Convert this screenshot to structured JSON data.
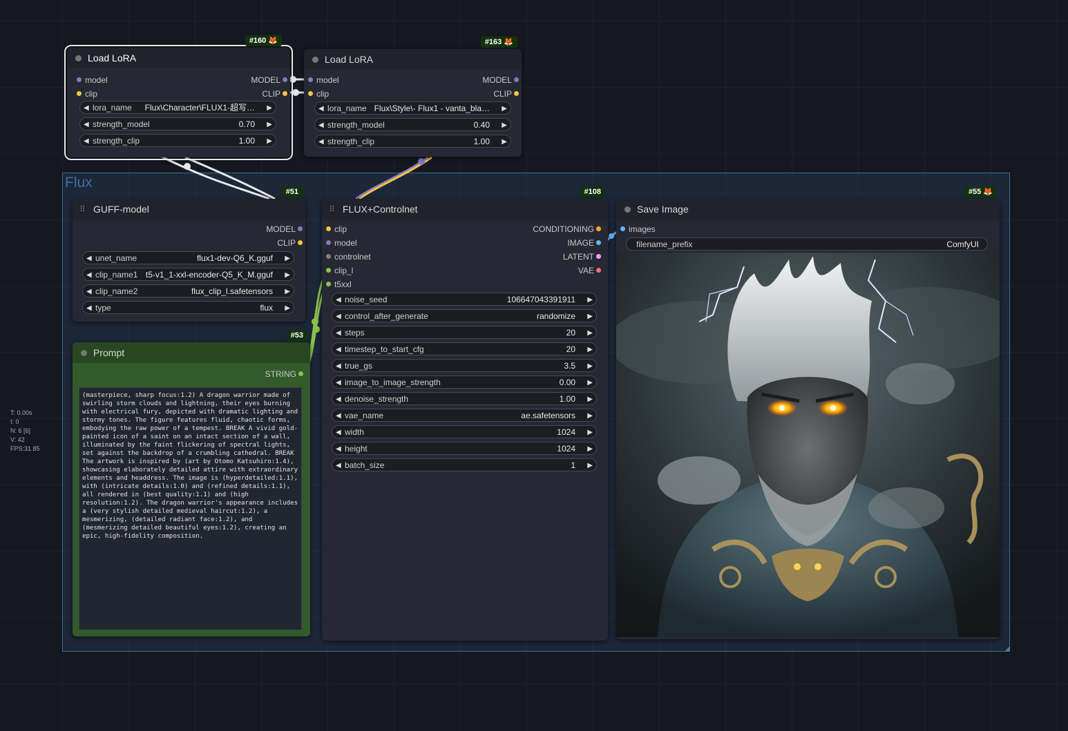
{
  "group": {
    "title": "Flux"
  },
  "stats": [
    "T: 0.00s",
    "I: 0",
    "N: 6 [6]",
    "V: 42",
    "FPS:31.85"
  ],
  "colors": {
    "model_socket": "#8678c4",
    "clip_socket": "#f5c542",
    "image_socket": "#64b5f6",
    "latent_socket": "#ff9cf9",
    "vae_socket": "#ff6e6e",
    "cond_socket": "#ffa931",
    "string_socket": "#8bc34a",
    "controlnet_socket": "#808080"
  },
  "lora1": {
    "badge": "#160",
    "title": "Load LoRA",
    "inputs": [
      "model",
      "clip"
    ],
    "outputs": [
      "MODEL",
      "CLIP"
    ],
    "widgets": [
      {
        "name": "lora_name",
        "value": "Flux\\Character\\FLUX1-超写…"
      },
      {
        "name": "strength_model",
        "value": "0.70"
      },
      {
        "name": "strength_clip",
        "value": "1.00"
      }
    ]
  },
  "lora2": {
    "badge": "#163",
    "title": "Load LoRA",
    "inputs": [
      "model",
      "clip"
    ],
    "outputs": [
      "MODEL",
      "CLIP"
    ],
    "widgets": [
      {
        "name": "lora_name",
        "value": "Flux\\Style\\- Flux1 - vanta_bla…"
      },
      {
        "name": "strength_model",
        "value": "0.40"
      },
      {
        "name": "strength_clip",
        "value": "1.00"
      }
    ]
  },
  "guff": {
    "badge": "#51",
    "title": "GUFF-model",
    "outputs": [
      "MODEL",
      "CLIP"
    ],
    "widgets": [
      {
        "name": "unet_name",
        "value": "flux1-dev-Q6_K.gguf"
      },
      {
        "name": "clip_name1",
        "value": "t5-v1_1-xxl-encoder-Q5_K_M.gguf"
      },
      {
        "name": "clip_name2",
        "value": "flux_clip_l.safetensors"
      },
      {
        "name": "type",
        "value": "flux"
      }
    ]
  },
  "prompt": {
    "badge": "#53",
    "title": "Prompt",
    "output": "STRING",
    "text": "(masterpiece, sharp focus:1.2) A dragon warrior made of swirling storm clouds and lightning, their eyes burning with electrical fury, depicted with dramatic lighting and stormy tones. The figure features fluid, chaotic forms, embodying the raw power of a tempest. BREAK A vivid gold-painted icon of a saint on an intact section of a wall, illuminated by the faint flickering of spectral lights, set against the backdrop of a crumbling cathedral. BREAK The artwork is inspired by (art by Otomo Katsuhiro:1.4), showcasing elaborately detailed attire with extraordinary elements and headdress. The image is (hyperdetailed:1.1), with (intricate details:1.0) and (refined details:1.1), all rendered in (best quality:1.1) and (high resolution:1.2). The dragon warrior's appearance includes a (very stylish detailed medieval haircut:1.2), a mesmerizing, (detailed radiant face:1.2), and (mesmerizing detailed beautiful eyes:1.2), creating an epic, high-fidelity composition."
  },
  "flux": {
    "badge": "#108",
    "title": "FLUX+Controlnet",
    "inputs": [
      "clip",
      "model",
      "controlnet",
      "clip_l",
      "t5xxl"
    ],
    "outputs": [
      "CONDITIONING",
      "IMAGE",
      "LATENT",
      "VAE"
    ],
    "widgets": [
      {
        "name": "noise_seed",
        "value": "106647043391911"
      },
      {
        "name": "control_after_generate",
        "value": "randomize"
      },
      {
        "name": "steps",
        "value": "20"
      },
      {
        "name": "timestep_to_start_cfg",
        "value": "20"
      },
      {
        "name": "true_gs",
        "value": "3.5"
      },
      {
        "name": "image_to_image_strength",
        "value": "0.00"
      },
      {
        "name": "denoise_strength",
        "value": "1.00"
      },
      {
        "name": "vae_name",
        "value": "ae.safetensors"
      },
      {
        "name": "width",
        "value": "1024"
      },
      {
        "name": "height",
        "value": "1024"
      },
      {
        "name": "batch_size",
        "value": "1"
      }
    ]
  },
  "save": {
    "badge": "#55",
    "title": "Save Image",
    "input": "images",
    "widget": {
      "name": "filename_prefix",
      "value": "ComfyUI"
    }
  }
}
